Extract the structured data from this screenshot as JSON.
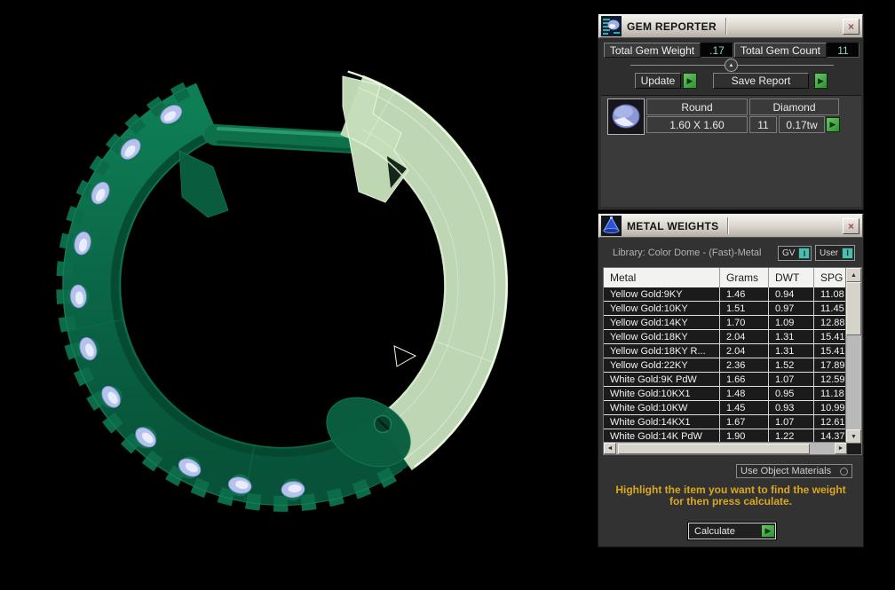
{
  "gem_reporter": {
    "title": "GEM REPORTER",
    "total_gem_weight_label": "Total Gem Weight",
    "total_gem_weight_value": ".17",
    "total_gem_count_label": "Total Gem Count",
    "total_gem_count_value": "11",
    "update_label": "Update",
    "save_report_label": "Save Report",
    "gem_row": {
      "shape": "Round",
      "type": "Diamond",
      "size": "1.60 X 1.60",
      "count": "11",
      "weight": "0.17tw"
    }
  },
  "metal_weights": {
    "title": "METAL WEIGHTS",
    "library_label": "Library: Color Dome - (Fast)-Metal",
    "gv_label": "GV",
    "gv_indicator": "I",
    "user_label": "User",
    "user_indicator": "I",
    "table": {
      "headers": [
        "Metal",
        "Grams",
        "DWT",
        "SPG"
      ],
      "rows": [
        {
          "metal": "Yellow Gold:9KY",
          "grams": "1.46",
          "dwt": "0.94",
          "spg": "11.08"
        },
        {
          "metal": "Yellow Gold:10KY",
          "grams": "1.51",
          "dwt": "0.97",
          "spg": "11.45"
        },
        {
          "metal": "Yellow Gold:14KY",
          "grams": "1.70",
          "dwt": "1.09",
          "spg": "12.88"
        },
        {
          "metal": "Yellow Gold:18KY",
          "grams": "2.04",
          "dwt": "1.31",
          "spg": "15.41"
        },
        {
          "metal": "Yellow Gold:18KY R...",
          "grams": "2.04",
          "dwt": "1.31",
          "spg": "15.41"
        },
        {
          "metal": "Yellow Gold:22KY",
          "grams": "2.36",
          "dwt": "1.52",
          "spg": "17.89"
        },
        {
          "metal": "White Gold:9K PdW",
          "grams": "1.66",
          "dwt": "1.07",
          "spg": "12.59"
        },
        {
          "metal": "White Gold:10KX1",
          "grams": "1.48",
          "dwt": "0.95",
          "spg": "11.18"
        },
        {
          "metal": "White Gold:10KW",
          "grams": "1.45",
          "dwt": "0.93",
          "spg": "10.99"
        },
        {
          "metal": "White Gold:14KX1",
          "grams": "1.67",
          "dwt": "1.07",
          "spg": "12.61"
        },
        {
          "metal": "White Gold:14K PdW",
          "grams": "1.90",
          "dwt": "1.22",
          "spg": "14.37"
        }
      ]
    },
    "use_object_materials_label": "Use Object Materials",
    "instruction_line1": "Highlight the item you want to find the weight",
    "instruction_line2": "for then press calculate.",
    "calculate_label": "Calculate"
  },
  "icons": {
    "close": "×",
    "arrow_right": "▶",
    "up_arrow": "▲",
    "scroll_up": "▲",
    "scroll_down": "▼",
    "scroll_left": "◄",
    "scroll_right": "►"
  },
  "colors": {
    "value_teal": "#86dcc0",
    "instruction_yellow": "#d9a81e",
    "indicator_teal": "#4fbcae",
    "button_green": "#3f9f3f",
    "ring_green": "#0a6546",
    "ring_pale_green": "#c6dfba",
    "gem_blue": "#b5c2ec"
  }
}
